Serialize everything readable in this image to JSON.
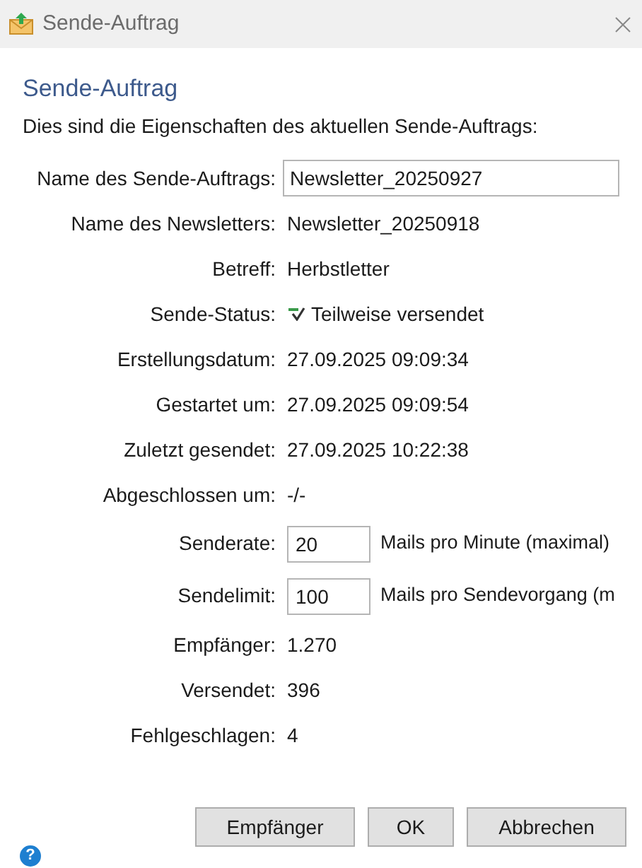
{
  "window": {
    "title": "Sende-Auftrag"
  },
  "heading": "Sende-Auftrag",
  "intro": "Dies sind die Eigenschaften des aktuellen Sende-Auftrags:",
  "fields": [
    {
      "kind": "input",
      "label": "Name des Sende-Auftrags:",
      "value": "Newsletter_20250927"
    },
    {
      "kind": "text",
      "label": "Name des Newsletters:",
      "value": "Newsletter_20250918"
    },
    {
      "kind": "text",
      "label": "Betreff:",
      "value": "Herbstletter"
    },
    {
      "kind": "status",
      "label": "Sende-Status:",
      "value": "Teilweise versendet"
    },
    {
      "kind": "text",
      "label": "Erstellungsdatum:",
      "value": "27.09.2025 09:09:34"
    },
    {
      "kind": "text",
      "label": "Gestartet um:",
      "value": "27.09.2025 09:09:54"
    },
    {
      "kind": "text",
      "label": "Zuletzt gesendet:",
      "value": "27.09.2025 10:22:38"
    },
    {
      "kind": "text",
      "label": "Abgeschlossen um:",
      "value": "-/-"
    },
    {
      "kind": "number",
      "label": "Senderate:",
      "value": "20",
      "unit": "Mails pro Minute (maximal)"
    },
    {
      "kind": "number",
      "label": "Sendelimit:",
      "value": "100",
      "unit": "Mails pro Sendevorgang (m"
    },
    {
      "kind": "text",
      "label": "Empfänger:",
      "value": "1.270"
    },
    {
      "kind": "text",
      "label": "Versendet:",
      "value": "396"
    },
    {
      "kind": "text",
      "label": "Fehlgeschlagen:",
      "value": "4"
    }
  ],
  "help": "?",
  "buttons": [
    "Empfänger",
    "OK",
    "Abbrechen"
  ]
}
